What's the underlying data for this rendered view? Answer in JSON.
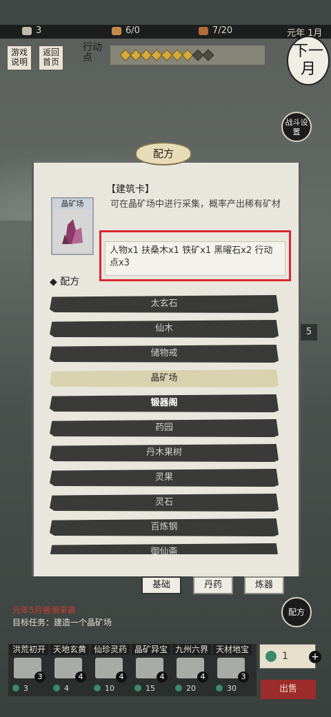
{
  "status_bar": {
    "population": "3",
    "food": "6/0",
    "cards": "7/20",
    "date": "元年 1月"
  },
  "top_buttons": {
    "game_help": "游戏说明",
    "back_home": "返回首页",
    "action_points_label": "行动点",
    "action_points_value": 7,
    "action_points_max": 9,
    "next_month": "下一月",
    "battle_settings": "战斗设置"
  },
  "dialog": {
    "title": "配方",
    "card_label": "晶矿场",
    "card_name": "【建筑卡】",
    "card_desc": "可在晶矿场中进行采集，概率产出稀有矿材",
    "cost_text": "人物x1 扶桑木x1 铁矿x1 黑曜石x2 行动点x3",
    "section_title": "◆ 配方",
    "recipes": [
      {
        "label": "太玄石",
        "state": "normal"
      },
      {
        "label": "仙木",
        "state": "normal"
      },
      {
        "label": "储物戒",
        "state": "normal"
      },
      {
        "label": "晶矿场",
        "state": "selected"
      },
      {
        "label": "锻器阁",
        "state": "bold"
      },
      {
        "label": "药园",
        "state": "normal"
      },
      {
        "label": "丹木果树",
        "state": "normal"
      },
      {
        "label": "灵果",
        "state": "normal"
      },
      {
        "label": "灵石",
        "state": "normal"
      },
      {
        "label": "百炼钢",
        "state": "normal"
      },
      {
        "label": "御仙斋",
        "state": "normal"
      }
    ],
    "tabs": [
      "基础",
      "丹药",
      "炼器"
    ]
  },
  "side": {
    "recipe_button": "配方",
    "partial_number": "5"
  },
  "event_text": "元年5月兽潮来袭",
  "goal_text": "目标任务：建造一个晶矿场",
  "packs": [
    {
      "label": "洪荒初开",
      "count": "3",
      "cost": "3"
    },
    {
      "label": "天地玄黄",
      "count": "4",
      "cost": "4"
    },
    {
      "label": "仙珍灵药",
      "count": "4",
      "cost": "10"
    },
    {
      "label": "晶矿异宝",
      "count": "4",
      "cost": "15"
    },
    {
      "label": "九州六界",
      "count": "4",
      "cost": "20"
    },
    {
      "label": "天材地宝",
      "count": "3",
      "cost": "30"
    }
  ],
  "sell": {
    "quantity": "1",
    "label": "出售"
  },
  "colors": {
    "highlight_border": "#d9272e",
    "selected_row": "#d8d2ae",
    "sell_button": "#9c2d2a"
  }
}
